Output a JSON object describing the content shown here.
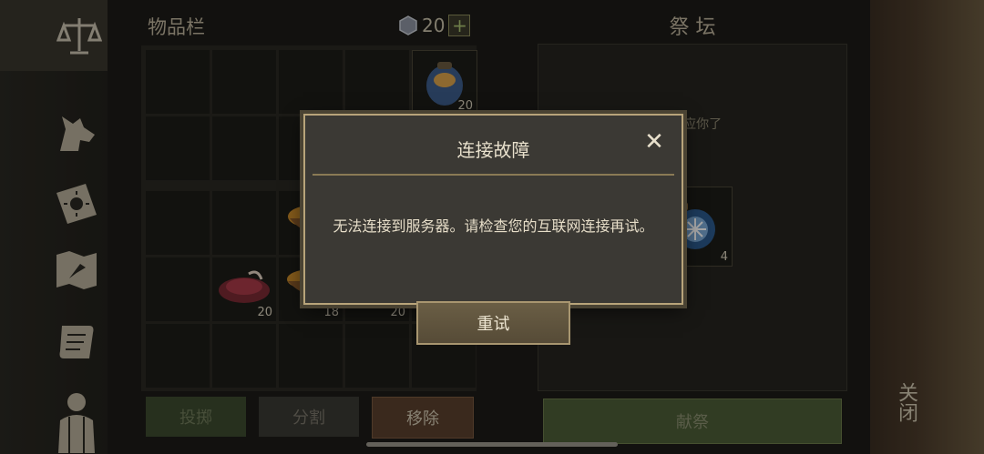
{
  "inventory": {
    "title": "物品栏",
    "currency_value": "20",
    "plus_label": "+",
    "slots": [
      {
        "qty": "20",
        "item": "blue-jar-icon"
      },
      {
        "qty": "20",
        "item": "meat-icon"
      },
      {
        "qty": "18",
        "item": "stew-bowl-icon"
      },
      {
        "qty": "20",
        "item": "blue-orb-icon"
      },
      {
        "qty": "20",
        "item": "blue-orb-icon"
      }
    ],
    "buttons": {
      "throw": "投掷",
      "split": "分割",
      "remove": "移除"
    }
  },
  "altar": {
    "title": "祭 坛",
    "message_fragment": "已经回应你了",
    "item_qty": "4",
    "offer_label": "献祭"
  },
  "side": {
    "close_label": "关闭"
  },
  "dialog": {
    "title": "连接故障",
    "message": "无法连接到服务器。请检查您的互联网连接再试。",
    "close_symbol": "✕",
    "retry_label": "重试"
  },
  "colors": {
    "dialog_border": "#b8a47a",
    "offer_green": "#4c5c36",
    "remove_brown": "#5a3f2d"
  }
}
